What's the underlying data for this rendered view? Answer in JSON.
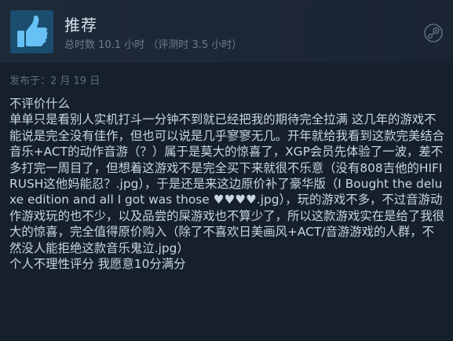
{
  "header": {
    "recommendation": "推荐",
    "hours": "总时数 10.1 小时 （评测时 3.5 小时）",
    "icons": {
      "thumb": "thumbs-up-icon",
      "platform": "steam-logo-icon"
    }
  },
  "review": {
    "posted": "发布于：2 月 19 日",
    "lines": [
      "不评价什么",
      "单单只是看别人实机打斗一分钟不到就已经把我的期待完全拉满 这几年的游戏不能说是完全没有佳作，但也可以说是几乎寥寥无几。开年就给我看到这款完美结合音乐+ACT的动作音游（？）属于是莫大的惊喜了，XGP会员先体验了一波，差不多打完一周目了，但想着这游戏不是完全买下来就很不乐意（没有808吉他的HIFIRUSH这他妈能忍？.jpg），于是还是来这边原价补了豪华版（I Bought the deluxe edition and all I got was those ♥♥♥♥.jpg），玩的游戏不多，不过音游动作游戏玩的也不少，以及品尝的屎游戏也不算少了，所以这款游戏实在是给了我很大的惊喜，完全值得原价购入（除了不喜欢日美画风+ACT/音游游戏的人群，不然没人能拒绝这款音乐鬼泣.jpg）",
      "个人不理性评分 我愿意10分满分"
    ]
  },
  "colors": {
    "background": "#16202d",
    "header": "#1f2a38",
    "thumb_box": "#1a4d6e",
    "thumb": "#67c1f5",
    "text": "#c8d6e1",
    "muted": "#6b7b8c"
  }
}
